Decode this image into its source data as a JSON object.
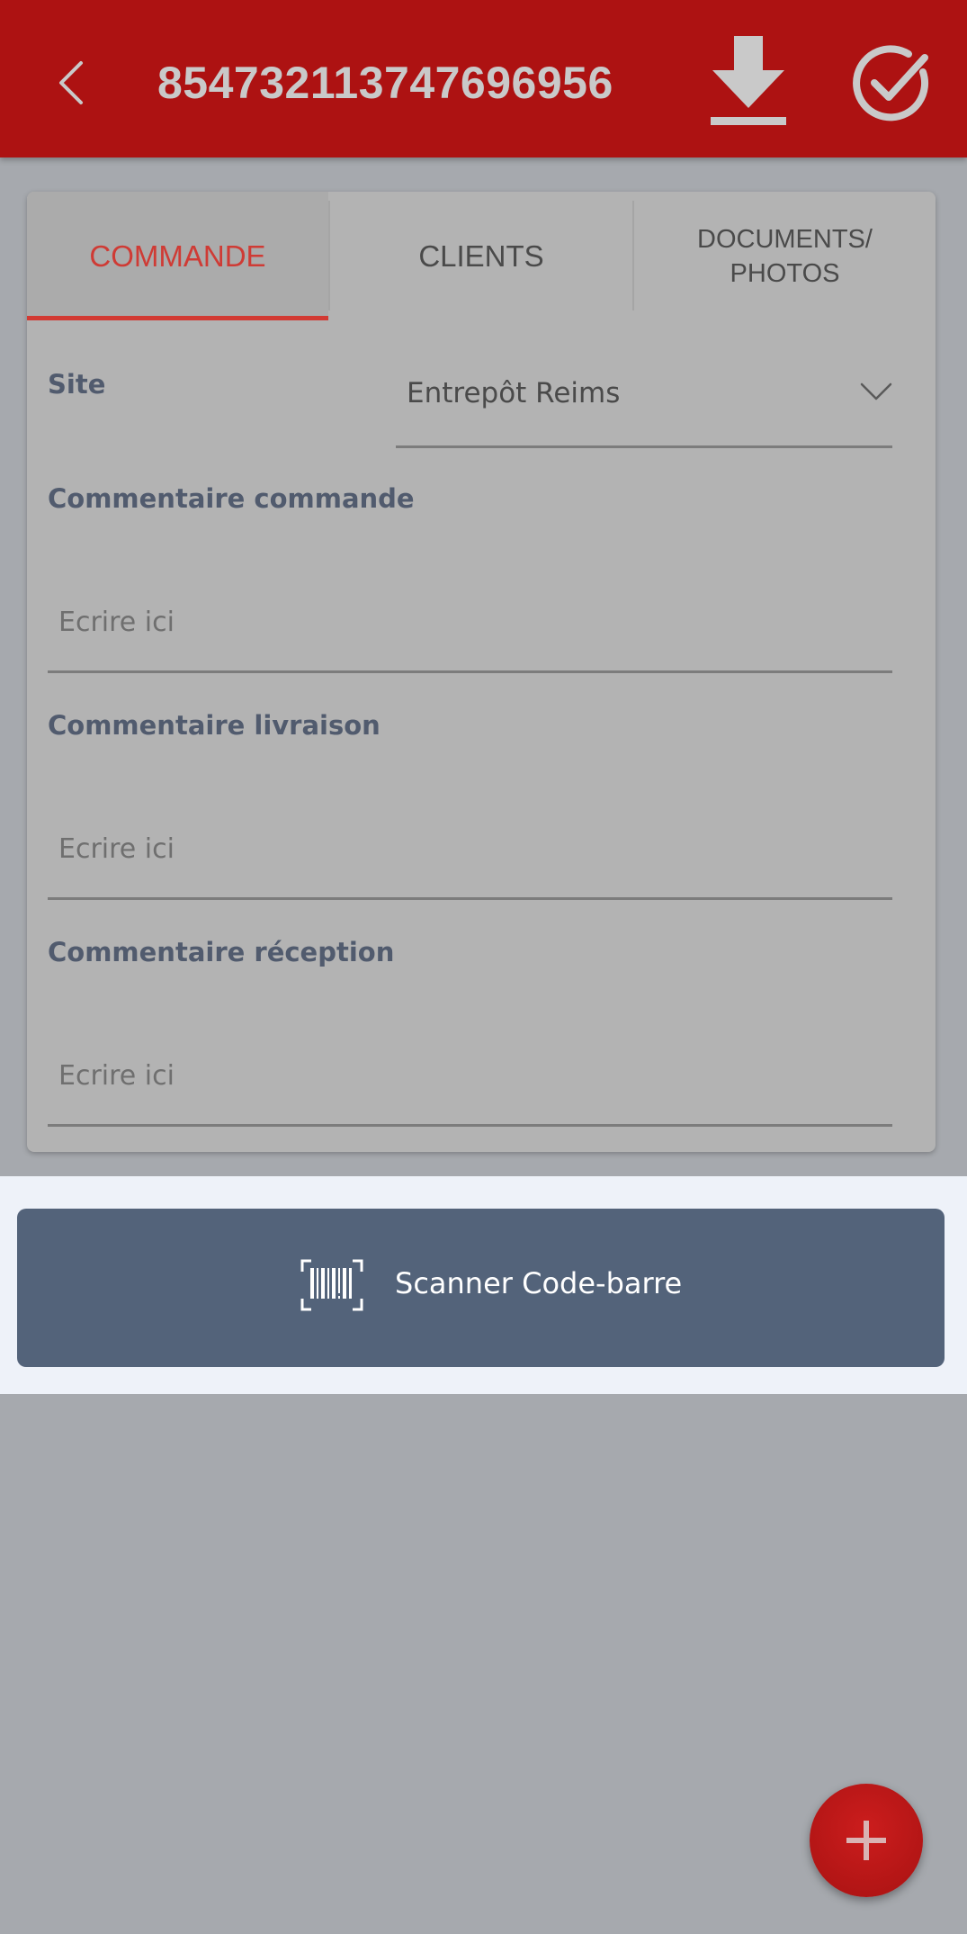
{
  "header": {
    "order_number": "854732113747696956"
  },
  "tabs": [
    {
      "label": "COMMANDE"
    },
    {
      "label": "CLIENTS"
    },
    {
      "label_line1": "DOCUMENTS/",
      "label_line2": "PHOTOS"
    }
  ],
  "form": {
    "site": {
      "label": "Site",
      "value": "Entrepôt Reims"
    },
    "order_comment": {
      "label": "Commentaire commande",
      "placeholder": "Ecrire ici"
    },
    "delivery_comment": {
      "label": "Commentaire livraison",
      "placeholder": "Ecrire ici"
    },
    "reception_comment": {
      "label": "Commentaire réception",
      "placeholder": "Ecrire ici"
    }
  },
  "scan": {
    "label": "Scanner Code-barre"
  },
  "colors": {
    "header_red": "#ad1212",
    "active_tab_red": "#cf3b35",
    "scan_button": "#53637a",
    "fab_red": "#cc1d1d"
  }
}
